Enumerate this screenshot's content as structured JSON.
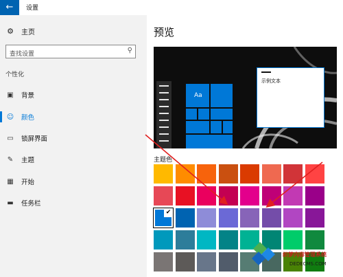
{
  "titlebar": {
    "back_label": "←",
    "title": "设置"
  },
  "sidebar": {
    "home_label": "主页",
    "search_placeholder": "查找设置",
    "section_heading": "个性化",
    "items": [
      {
        "label": "背景",
        "icon": "picture-icon",
        "glyph": "▣",
        "active": false
      },
      {
        "label": "颜色",
        "icon": "palette-icon",
        "glyph": "☺",
        "active": true
      },
      {
        "label": "锁屏界面",
        "icon": "lock-screen-icon",
        "glyph": "▭",
        "active": false
      },
      {
        "label": "主题",
        "icon": "theme-brush-icon",
        "glyph": "✎",
        "active": false
      },
      {
        "label": "开始",
        "icon": "start-grid-icon",
        "glyph": "▦",
        "active": false
      },
      {
        "label": "任务栏",
        "icon": "taskbar-icon",
        "glyph": "▬",
        "active": false
      }
    ]
  },
  "main": {
    "page_title": "预览",
    "preview": {
      "tile_label": "Aa",
      "window_text": "示例文本"
    },
    "colors_label": "主题色",
    "selected_color": "#0078d7",
    "color_rows": [
      [
        "#ffb900",
        "#ff8c00",
        "#f7630c",
        "#ca5010",
        "#da3b01",
        "#ef6950",
        "#d13438",
        "#ff4343"
      ],
      [
        "#e74856",
        "#e81123",
        "#ea005e",
        "#c30052",
        "#e3008c",
        "#bf0077",
        "#c239b3",
        "#9a0089"
      ],
      [
        "#0078d7",
        "#0063b1",
        "#8e8cd8",
        "#6b69d6",
        "#8764b8",
        "#744da9",
        "#b146c2",
        "#881798"
      ],
      [
        "#0099bc",
        "#2d7d9a",
        "#00b7c3",
        "#038387",
        "#00b294",
        "#018574",
        "#00cc6a",
        "#10893e"
      ],
      [
        "#7a7574",
        "#5d5a58",
        "#68768a",
        "#515c6b",
        "#567c73",
        "#486860",
        "#498205",
        "#107c10"
      ]
    ]
  },
  "watermark": {
    "text": "织梦内容管理系统",
    "url": "DEDECMS.COM"
  }
}
